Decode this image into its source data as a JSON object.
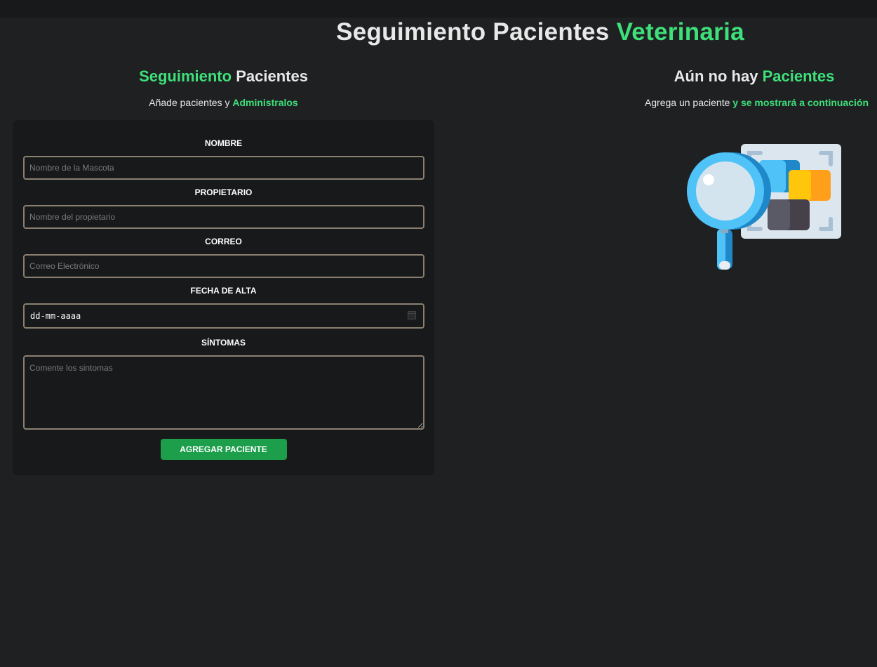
{
  "header": {
    "title_part1": "Seguimiento Pacientes",
    "title_part2": "Veterinaria"
  },
  "form_section": {
    "title_part1": "Seguimiento",
    "title_part2": "Pacientes",
    "subtitle_part1": "Añade pacientes y",
    "subtitle_part2": "Administralos"
  },
  "form": {
    "nombre_label": "Nombre",
    "nombre_placeholder": "Nombre de la Mascota",
    "propietario_label": "Propietario",
    "propietario_placeholder": "Nombre del propietario",
    "correo_label": "Correo",
    "correo_placeholder": "Correo Electrónico",
    "fecha_label": "Fecha de Alta",
    "fecha_value": "dd-mm-aaaa",
    "sintomas_label": "Síntomas",
    "sintomas_placeholder": "Comente los sintomas",
    "submit_label": "Agregar Paciente"
  },
  "list_section": {
    "title_part1": "Aún no hay",
    "title_part2": "Pacientes",
    "subtitle_part1": "Agrega un paciente",
    "subtitle_part2": "y se mostrará a continuación"
  },
  "colors": {
    "accent": "#3ee07a",
    "button": "#1c9e4b",
    "background": "#1f2022",
    "card": "#18191b"
  },
  "icons": {
    "illustration": "magnifier-search-icon",
    "date_picker": "calendar-icon"
  }
}
